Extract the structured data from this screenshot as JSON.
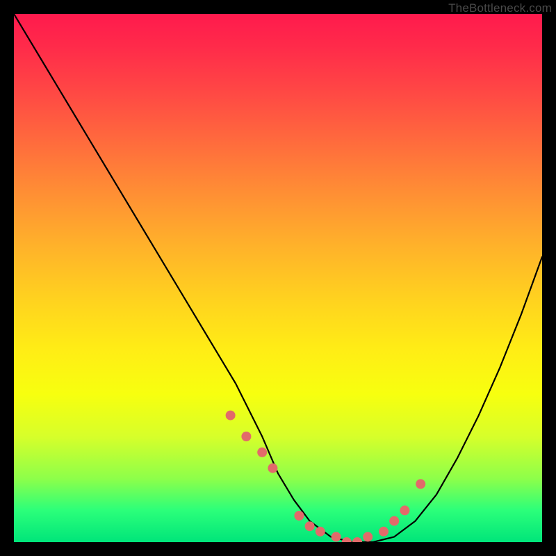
{
  "watermark": {
    "text": "TheBottleneck.com"
  },
  "chart_data": {
    "type": "line",
    "title": "",
    "xlabel": "",
    "ylabel": "",
    "xlim": [
      0,
      100
    ],
    "ylim": [
      0,
      100
    ],
    "series": [
      {
        "name": "bottleneck-curve",
        "x": [
          0,
          6,
          12,
          18,
          24,
          30,
          36,
          42,
          47,
          50,
          53,
          56,
          60,
          64,
          68,
          72,
          76,
          80,
          84,
          88,
          92,
          96,
          100
        ],
        "values": [
          100,
          90,
          80,
          70,
          60,
          50,
          40,
          30,
          20,
          13,
          8,
          4,
          1,
          0,
          0,
          1,
          4,
          9,
          16,
          24,
          33,
          43,
          54
        ]
      }
    ],
    "markers": {
      "name": "highlight-dots",
      "color": "#e26a6a",
      "radius_px": 7,
      "x": [
        41,
        44,
        47,
        49,
        54,
        56,
        58,
        61,
        63,
        65,
        67,
        70,
        72,
        74,
        77
      ],
      "values": [
        24,
        20,
        17,
        14,
        5,
        3,
        2,
        1,
        0,
        0,
        1,
        2,
        4,
        6,
        11
      ]
    }
  }
}
